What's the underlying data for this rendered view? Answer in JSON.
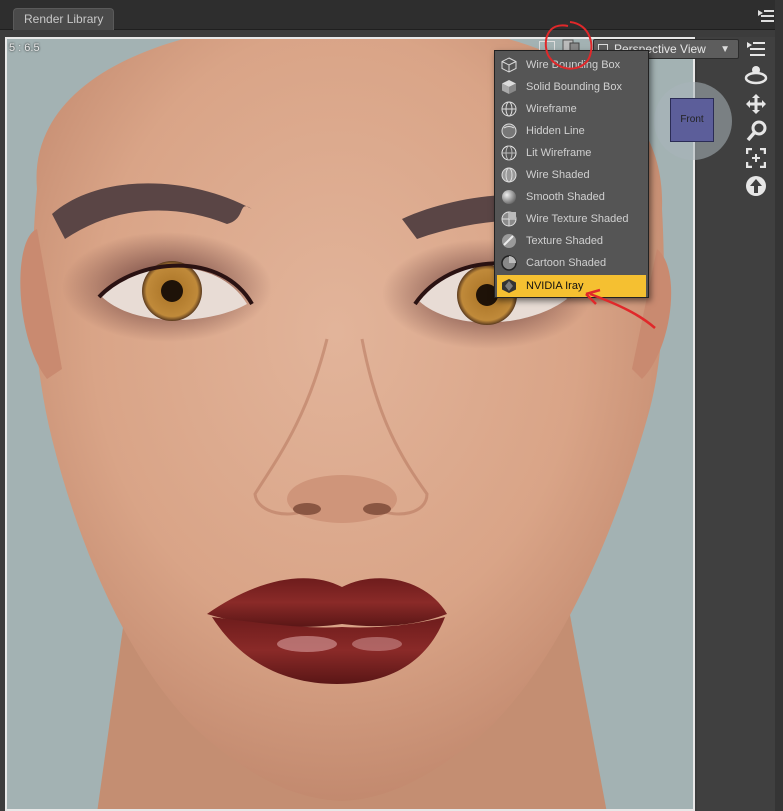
{
  "tabs": [
    {
      "label": "Render Library"
    }
  ],
  "viewport": {
    "aspect_label": "5 : 6.5",
    "view_selector": {
      "label": "Perspective View"
    },
    "navigator": {
      "face_label": "Front"
    }
  },
  "draw_style_menu": {
    "items": [
      {
        "label": "Wire Bounding Box",
        "icon": "wire-bounding-box-icon"
      },
      {
        "label": "Solid Bounding Box",
        "icon": "solid-bounding-box-icon"
      },
      {
        "label": "Wireframe",
        "icon": "wireframe-icon"
      },
      {
        "label": "Hidden Line",
        "icon": "hidden-line-icon"
      },
      {
        "label": "Lit Wireframe",
        "icon": "lit-wireframe-icon"
      },
      {
        "label": "Wire Shaded",
        "icon": "wire-shaded-icon"
      },
      {
        "label": "Smooth Shaded",
        "icon": "smooth-shaded-icon"
      },
      {
        "label": "Wire Texture Shaded",
        "icon": "wire-texture-shaded-icon"
      },
      {
        "label": "Texture Shaded",
        "icon": "texture-shaded-icon"
      },
      {
        "label": "Cartoon Shaded",
        "icon": "cartoon-shaded-icon"
      },
      {
        "label": "NVIDIA Iray",
        "icon": "nvidia-iray-icon",
        "selected": true
      }
    ]
  },
  "toolbar": {
    "tools": [
      "viewport-options-icon",
      "orbit-icon",
      "pan-icon",
      "zoom-icon",
      "frame-icon",
      "reset-view-icon"
    ]
  },
  "colors": {
    "selected_item": "#f5c031",
    "menu_bg": "#555555",
    "annotation_red": "#e0282a",
    "viewport_bg": "#a3b2b3"
  }
}
